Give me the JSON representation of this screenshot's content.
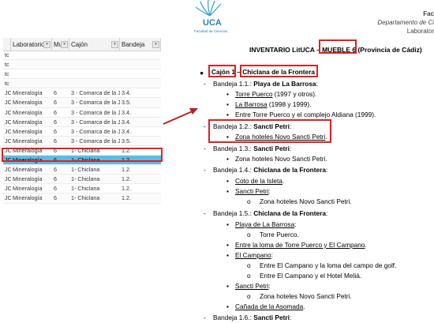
{
  "sheet": {
    "columns": [
      "",
      "Laboratorio",
      "Mu",
      "Cajón",
      "Bandeja"
    ],
    "rows": [
      [
        "tc",
        "",
        "",
        "",
        ""
      ],
      [
        "tc",
        "",
        "",
        "",
        ""
      ],
      [
        "tc",
        "",
        "",
        "",
        ""
      ],
      [
        "tc",
        "",
        "",
        "",
        ""
      ],
      [
        "JC",
        "Mineralogía",
        "6",
        "3 - Comarca de la J",
        "3.4."
      ],
      [
        "JC",
        "Mineralogía",
        "6",
        "3 - Comarca de la J",
        "3.5."
      ],
      [
        "JC",
        "Mineralogía",
        "6",
        "3 - Comarca de la J",
        "3.4."
      ],
      [
        "JC",
        "Mineralogía",
        "6",
        "3 - Comarca de la J",
        "3.4."
      ],
      [
        "JC",
        "Mineralogía",
        "6",
        "3 - Comarca de la J",
        "3.4."
      ],
      [
        "JC",
        "Mineralogía",
        "6",
        "3 - Comarca de la J",
        "3.5."
      ],
      [
        "JC",
        "Mineralogía",
        "6",
        "1- Chiclana",
        "1.2."
      ],
      [
        "JC",
        "Mineralogía",
        "6",
        "1- Chiclana",
        "1.2."
      ],
      [
        "JC",
        "Mineralogía",
        "6",
        "1- Chiclana",
        "1.2."
      ],
      [
        "JC",
        "Mineralogía",
        "6",
        "1- Chiclana",
        "1.2."
      ],
      [
        "JC",
        "Mineralogía",
        "6",
        "1- Chiclana",
        "1.2."
      ],
      [
        "JC",
        "Mineralogía",
        "6",
        "1- Chiclana",
        "1.2."
      ]
    ],
    "selected_index": 11
  },
  "header": {
    "logo": "UCA",
    "logo_sub": "Facultad de Ciencias",
    "right_line1": "Fac",
    "right_line2": "Departamento de Ci",
    "right_line3": "Laborator"
  },
  "doc": {
    "title_pre": "INVENTARIO LitUCA – ",
    "title_mueble": "MUEBLE 6",
    "title_post": " (Provincia de Cádiz)",
    "cajon_label": "Cajón 1",
    "cajon_sep": " – ",
    "cajon_name": "Chiclana de la Frontera",
    "b11_label": "Bandeja 1.1.: ",
    "b11_name": "Playa de La Barrosa",
    "b11_colon": ":",
    "b11_i1": "Torre Puerco",
    "b11_i1_rest": " (1997 y otros).",
    "b11_i2": "La Barrosa",
    "b11_i2_rest": " (1998 y 1999).",
    "b11_i3": "Entre Torre Puerco y el complejo Aldiana (1999).",
    "b12_label": "Bandeja 1.2.: ",
    "b12_name": "Sancti Petri",
    "b12_colon": ":",
    "b12_i1": "Zona hoteles Novo Sancti Petri",
    "b12_i1_rest": ".",
    "b13_label": "Bandeja 1.3.: ",
    "b13_name": "Sancti Petri",
    "b13_colon": ":",
    "b13_i1": "Zona hoteles Novo Sancti Petri.",
    "b14_label": "Bandeja 1.4.: ",
    "b14_name": "Chiclana de la Frontera",
    "b14_colon": ":",
    "b14_i1": "Coto de la Isleta",
    "b14_i1_rest": ".",
    "b14_i2": "Sancti Petri",
    "b14_i2_rest": ":",
    "b14_i2a": "Zona hoteles Novo Sancti Petri.",
    "b15_label": "Bandeja 1.5.: ",
    "b15_name": "Chiclana de la Frontera",
    "b15_colon": ":",
    "b15_i1": "Playa de La Barrosa",
    "b15_i1_rest": ":",
    "b15_i1a": "Torre Puerco.",
    "b15_i2": "Entre la loma de Torre Puerco y El Campano",
    "b15_i2_rest": ".",
    "b15_i3": "El Campano",
    "b15_i3_rest": ":",
    "b15_i3a": "Entre El Campano y la loma del campo de golf.",
    "b15_i3b": "Entre El Campano y el Hotel Meliá.",
    "b15_i4": "Sancti Petri",
    "b15_i4_rest": ":",
    "b15_i4a": "Zona hoteles Novo Sancti Petri.",
    "b15_i5": "Cañada de la Asomada",
    "b15_i5_rest": ".",
    "b16_label": "Bandeja 1.6.: ",
    "b16_name": "Sancti Petri",
    "b16_colon": ":"
  }
}
